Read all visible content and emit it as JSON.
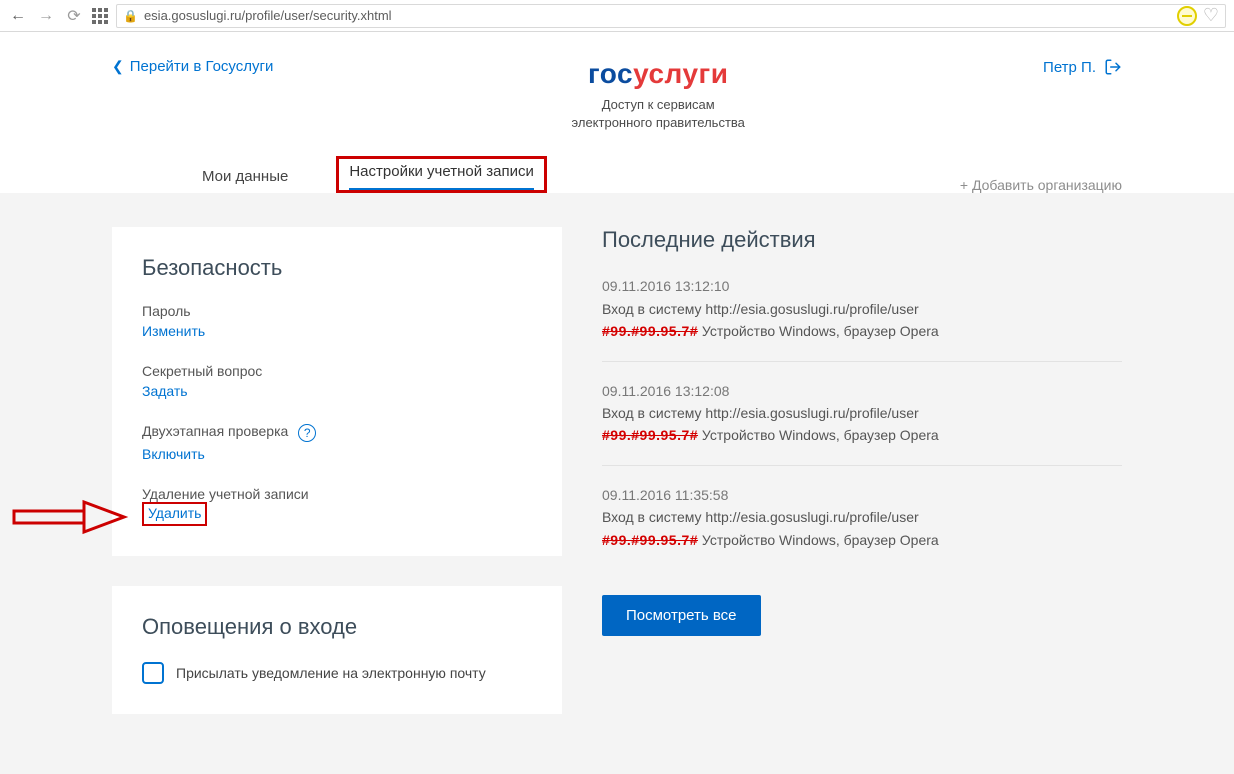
{
  "browser": {
    "url": "esia.gosuslugi.ru/profile/user/security.xhtml"
  },
  "header": {
    "back_link": "Перейти в Госуслуги",
    "logo_part1": "гос",
    "logo_part2": "услуги",
    "tagline_l1": "Доступ к сервисам",
    "tagline_l2": "электронного правительства",
    "user_name": "Петр П."
  },
  "tabs": {
    "my_data": "Мои данные",
    "account_settings": "Настройки учетной записи",
    "add_org": "Добавить организацию"
  },
  "security_card": {
    "title": "Безопасность",
    "password_label": "Пароль",
    "password_action": "Изменить",
    "secret_q_label": "Секретный вопрос",
    "secret_q_action": "Задать",
    "twostep_label": "Двухэтапная проверка",
    "twostep_action": "Включить",
    "delete_label": "Удаление учетной записи",
    "delete_action": "Удалить"
  },
  "notifications_card": {
    "title": "Оповещения о входе",
    "email_label": "Присылать уведомление на электронную почту"
  },
  "activity": {
    "title": "Последние действия",
    "items": [
      {
        "date": "09.11.2016 13:12:10",
        "line": "Вход в систему http://esia.gosuslugi.ru/profile/user",
        "redacted": "#99.#99.95.7#",
        "device": " Устройство Windows, браузер Opera"
      },
      {
        "date": "09.11.2016 13:12:08",
        "line": "Вход в систему http://esia.gosuslugi.ru/profile/user",
        "redacted": "#99.#99.95.7#",
        "device": " Устройство Windows, браузер Opera"
      },
      {
        "date": "09.11.2016 11:35:58",
        "line": "Вход в систему http://esia.gosuslugi.ru/profile/user",
        "redacted": "#99.#99.95.7#",
        "device": " Устройство Windows, браузер Opera"
      }
    ],
    "view_all": "Посмотреть все"
  }
}
